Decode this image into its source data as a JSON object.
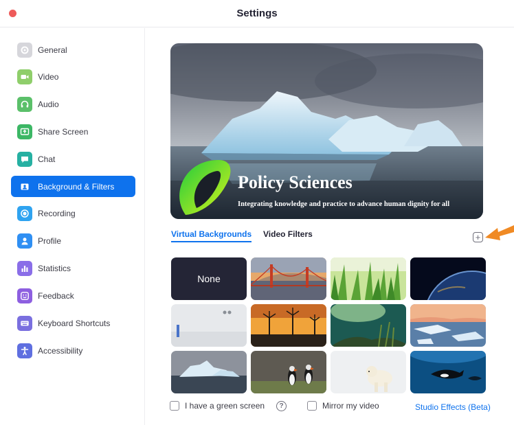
{
  "window": {
    "title": "Settings"
  },
  "sidebar": {
    "items": [
      {
        "label": "General",
        "icon": "gear-icon",
        "color": "#d6d6db",
        "active": false
      },
      {
        "label": "Video",
        "icon": "video-camera-icon",
        "color": "#8fce6b",
        "active": false
      },
      {
        "label": "Audio",
        "icon": "headphones-icon",
        "color": "#5bc06a",
        "active": false
      },
      {
        "label": "Share Screen",
        "icon": "share-screen-icon",
        "color": "#3cb765",
        "active": false
      },
      {
        "label": "Chat",
        "icon": "chat-bubble-icon",
        "color": "#26b0a2",
        "active": false
      },
      {
        "label": "Background & Filters",
        "icon": "person-portrait-icon",
        "color": "#0e72ed",
        "active": true
      },
      {
        "label": "Recording",
        "icon": "record-icon",
        "color": "#2fa3f0",
        "active": false
      },
      {
        "label": "Profile",
        "icon": "person-icon",
        "color": "#2f8ff3",
        "active": false
      },
      {
        "label": "Statistics",
        "icon": "bar-chart-icon",
        "color": "#8a6ee8",
        "active": false
      },
      {
        "label": "Feedback",
        "icon": "smiley-icon",
        "color": "#8d5fe0",
        "active": false
      },
      {
        "label": "Keyboard Shortcuts",
        "icon": "keyboard-icon",
        "color": "#7a6fdf",
        "active": false
      },
      {
        "label": "Accessibility",
        "icon": "accessibility-icon",
        "color": "#5f6fe0",
        "active": false
      }
    ]
  },
  "preview": {
    "brand_name": "Policy Sciences",
    "tagline": "Integrating knowledge and practice to advance human dignity for all"
  },
  "tabs": {
    "virtual": "Virtual Backgrounds",
    "filters": "Video Filters",
    "active": "virtual"
  },
  "backgrounds": {
    "none_label": "None",
    "thumbnails": [
      {
        "name": "golden-gate-bridge"
      },
      {
        "name": "grass"
      },
      {
        "name": "earth-from-space"
      },
      {
        "name": "meeting-room"
      },
      {
        "name": "wind-turbines"
      },
      {
        "name": "underwater-sunlight"
      },
      {
        "name": "ice-floes"
      },
      {
        "name": "iceberg"
      },
      {
        "name": "puffins"
      },
      {
        "name": "polar-bear"
      },
      {
        "name": "orca"
      }
    ]
  },
  "options": {
    "green_screen": {
      "label": "I have a green screen",
      "checked": false,
      "help_symbol": "?"
    },
    "mirror": {
      "label": "Mirror my video",
      "checked": false
    }
  },
  "studio_effects": "Studio Effects (Beta)",
  "add_button_symbol": "+",
  "colors": {
    "accent": "#0e72ed",
    "arrow": "#f08a24",
    "close_dot": "#ee5b5a"
  }
}
